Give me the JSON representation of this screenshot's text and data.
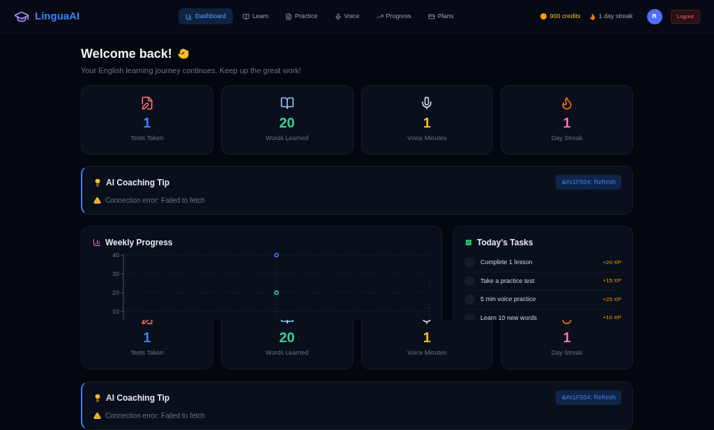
{
  "brand": {
    "name": "LinguaAI"
  },
  "nav": [
    {
      "label": "Dashboard",
      "selected": true
    },
    {
      "label": "Learn",
      "selected": false
    },
    {
      "label": "Practice",
      "selected": false
    },
    {
      "label": "Voice",
      "selected": false
    },
    {
      "label": "Progress",
      "selected": false
    },
    {
      "label": "Plans",
      "selected": false
    }
  ],
  "header": {
    "credits": "900 credits",
    "streak": "1 day streak",
    "avatar": "R",
    "logout": "Logout"
  },
  "welcome": {
    "title": "Welcome back!",
    "subtitle": "Your English learning journey continues. Keep up the great work!"
  },
  "stats": [
    {
      "value": "1",
      "label": "Tests Taken",
      "color": "#3b82f6"
    },
    {
      "value": "20",
      "label": "Words Learned",
      "color": "#34d399"
    },
    {
      "value": "1",
      "label": "Voice Minutes",
      "color": "#fbbf24"
    },
    {
      "value": "1",
      "label": "Day Streak",
      "color": "#f472b6"
    }
  ],
  "tip": {
    "title": "AI Coaching Tip",
    "button": "&#x1F504; Refresh",
    "message": "Connection error: Failed to fetch"
  },
  "weekly_progress": {
    "title": "Weekly Progress",
    "chart_data": {
      "type": "line",
      "grid": true,
      "ylim": [
        0,
        40
      ],
      "yticks": [
        10,
        20,
        30,
        40
      ],
      "series": [
        {
          "color": "#3b82f6",
          "marker": true,
          "values": [
            null,
            40,
            null
          ]
        },
        {
          "color": "#34d399",
          "marker": true,
          "values": [
            null,
            20,
            null
          ]
        }
      ]
    }
  },
  "tasks": {
    "title": "Today's Tasks",
    "items": [
      {
        "label": "Complete 1 lesson",
        "xp": "+20 XP",
        "checked": false
      },
      {
        "label": "Take a practice test",
        "xp": "+15 XP",
        "checked": false
      },
      {
        "label": "5 min voice practice",
        "xp": "+25 XP",
        "checked": false
      },
      {
        "label": "Learn 10 new words",
        "xp": "+10 XP",
        "checked": false
      }
    ]
  },
  "repeated": {
    "stats": [
      {
        "value": "1",
        "label": "Tests Taken",
        "color": "#3b82f6"
      },
      {
        "value": "20",
        "label": "Words Learned",
        "color": "#34d399"
      },
      {
        "value": "1",
        "label": "Voice Minutes",
        "color": "#fbbf24"
      },
      {
        "value": "1",
        "label": "Day Streak",
        "color": "#f472b6"
      }
    ],
    "tip": {
      "title": "AI Coaching Tip",
      "button": "&#x1F504; Refresh",
      "message": "Connection error: Failed to fetch"
    }
  }
}
